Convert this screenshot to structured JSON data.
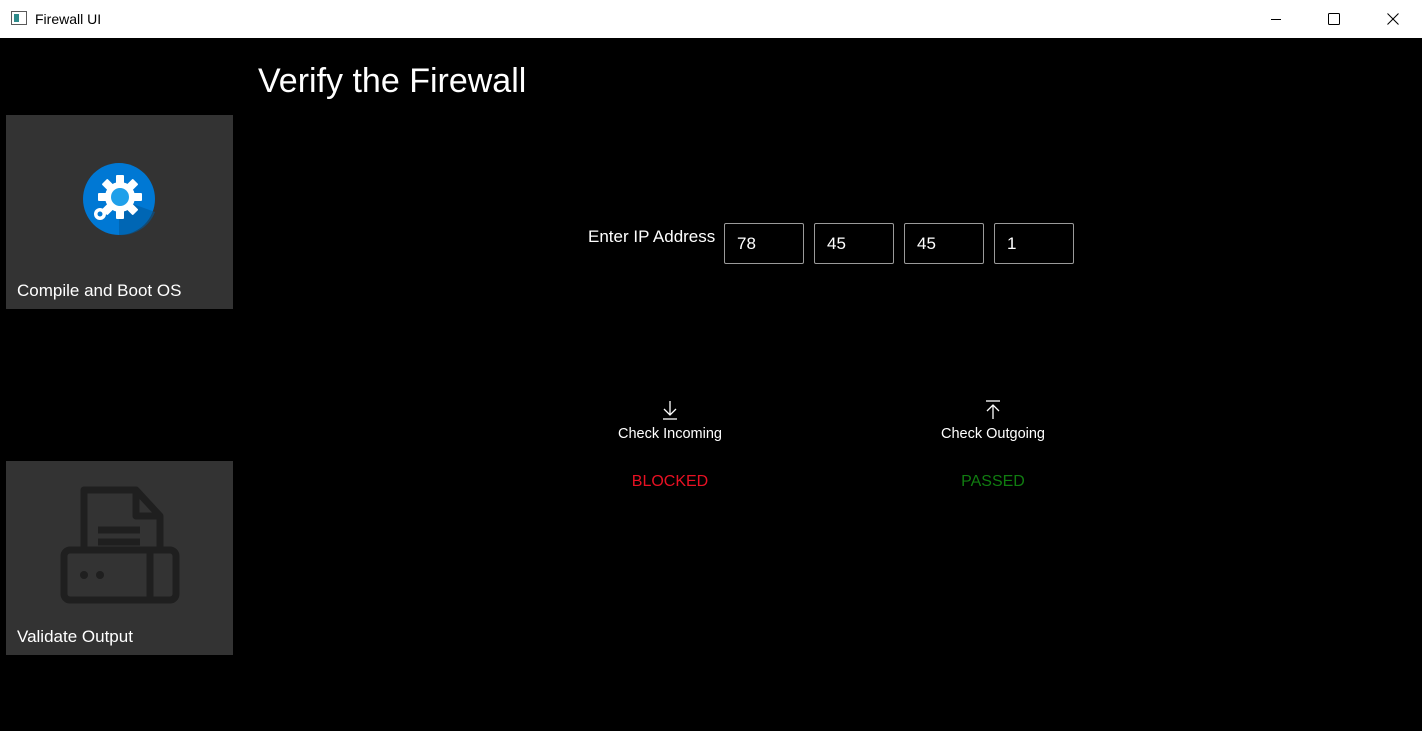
{
  "window": {
    "title": "Firewall UI",
    "controls": [
      "minimize-icon",
      "maximize-icon",
      "close-icon"
    ]
  },
  "sidebar": {
    "items": [
      {
        "label": "Compile and Boot OS",
        "icon": "gear-icon",
        "icon_color": "#0078d4"
      },
      {
        "label": "Validate Output",
        "icon": "printer-icon",
        "icon_color": "#1f1f1f"
      }
    ],
    "tile_color": "#333333"
  },
  "main": {
    "title": "Verify the Firewall",
    "ip": {
      "label": "Enter IP Address",
      "octets": [
        "78",
        "45",
        "45",
        "1"
      ]
    },
    "checks": {
      "incoming": {
        "label": "Check Incoming",
        "icon": "arrow-down-icon",
        "status": "BLOCKED",
        "status_color": "#e81123"
      },
      "outgoing": {
        "label": "Check Outgoing",
        "icon": "arrow-up-icon",
        "status": "PASSED",
        "status_color": "#107c10"
      }
    }
  }
}
